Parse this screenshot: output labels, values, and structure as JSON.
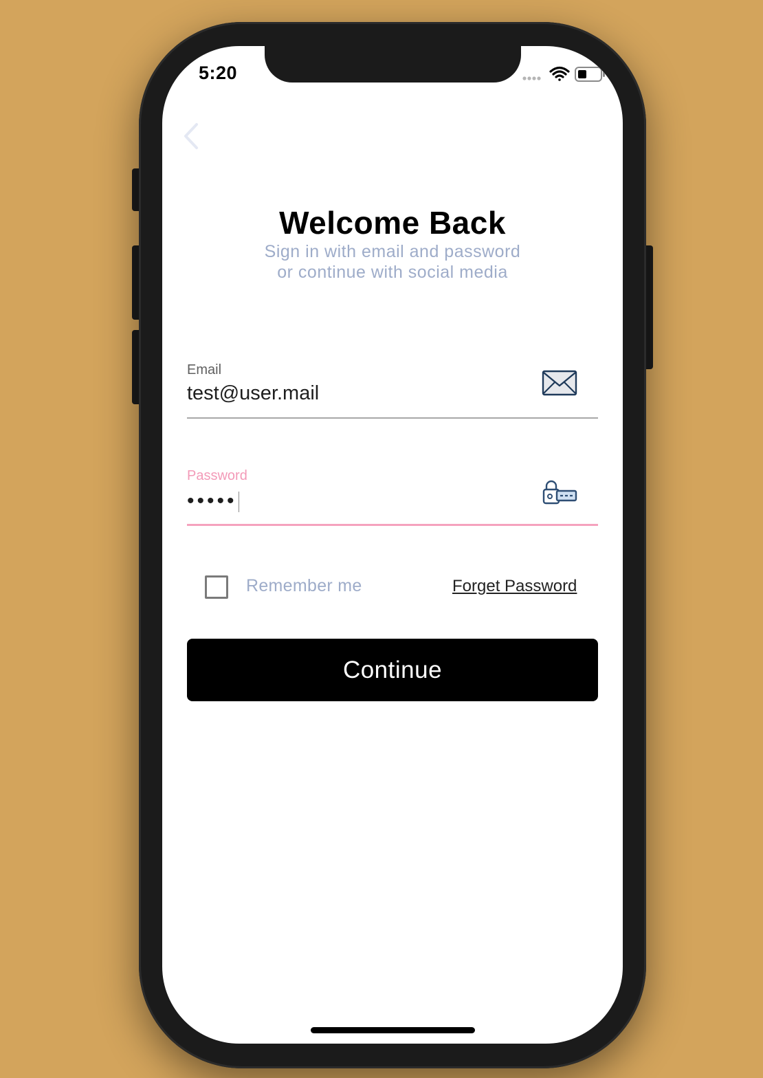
{
  "status_bar": {
    "time": "5:20",
    "icons": [
      "signal-dots-icon",
      "wifi-icon",
      "battery-icon"
    ]
  },
  "nav": {
    "back_icon": "chevron-left-icon"
  },
  "header": {
    "title": "Welcome Back",
    "subtitle_line1": "Sign in with email and password",
    "subtitle_line2": "or continue with social media"
  },
  "form": {
    "email": {
      "label": "Email",
      "value": "test@user.mail",
      "icon": "envelope-icon"
    },
    "password": {
      "label": "Password",
      "value": "•••••",
      "icon": "lock-key-icon",
      "focused": true
    },
    "remember_label": "Remember me",
    "remember_checked": false,
    "forgot_label": "Forget Password",
    "submit_label": "Continue"
  },
  "colors": {
    "background": "#D3A45C",
    "accent_pink": "#F5A2BE",
    "muted_text": "#9EACC9",
    "button": "#000000"
  }
}
